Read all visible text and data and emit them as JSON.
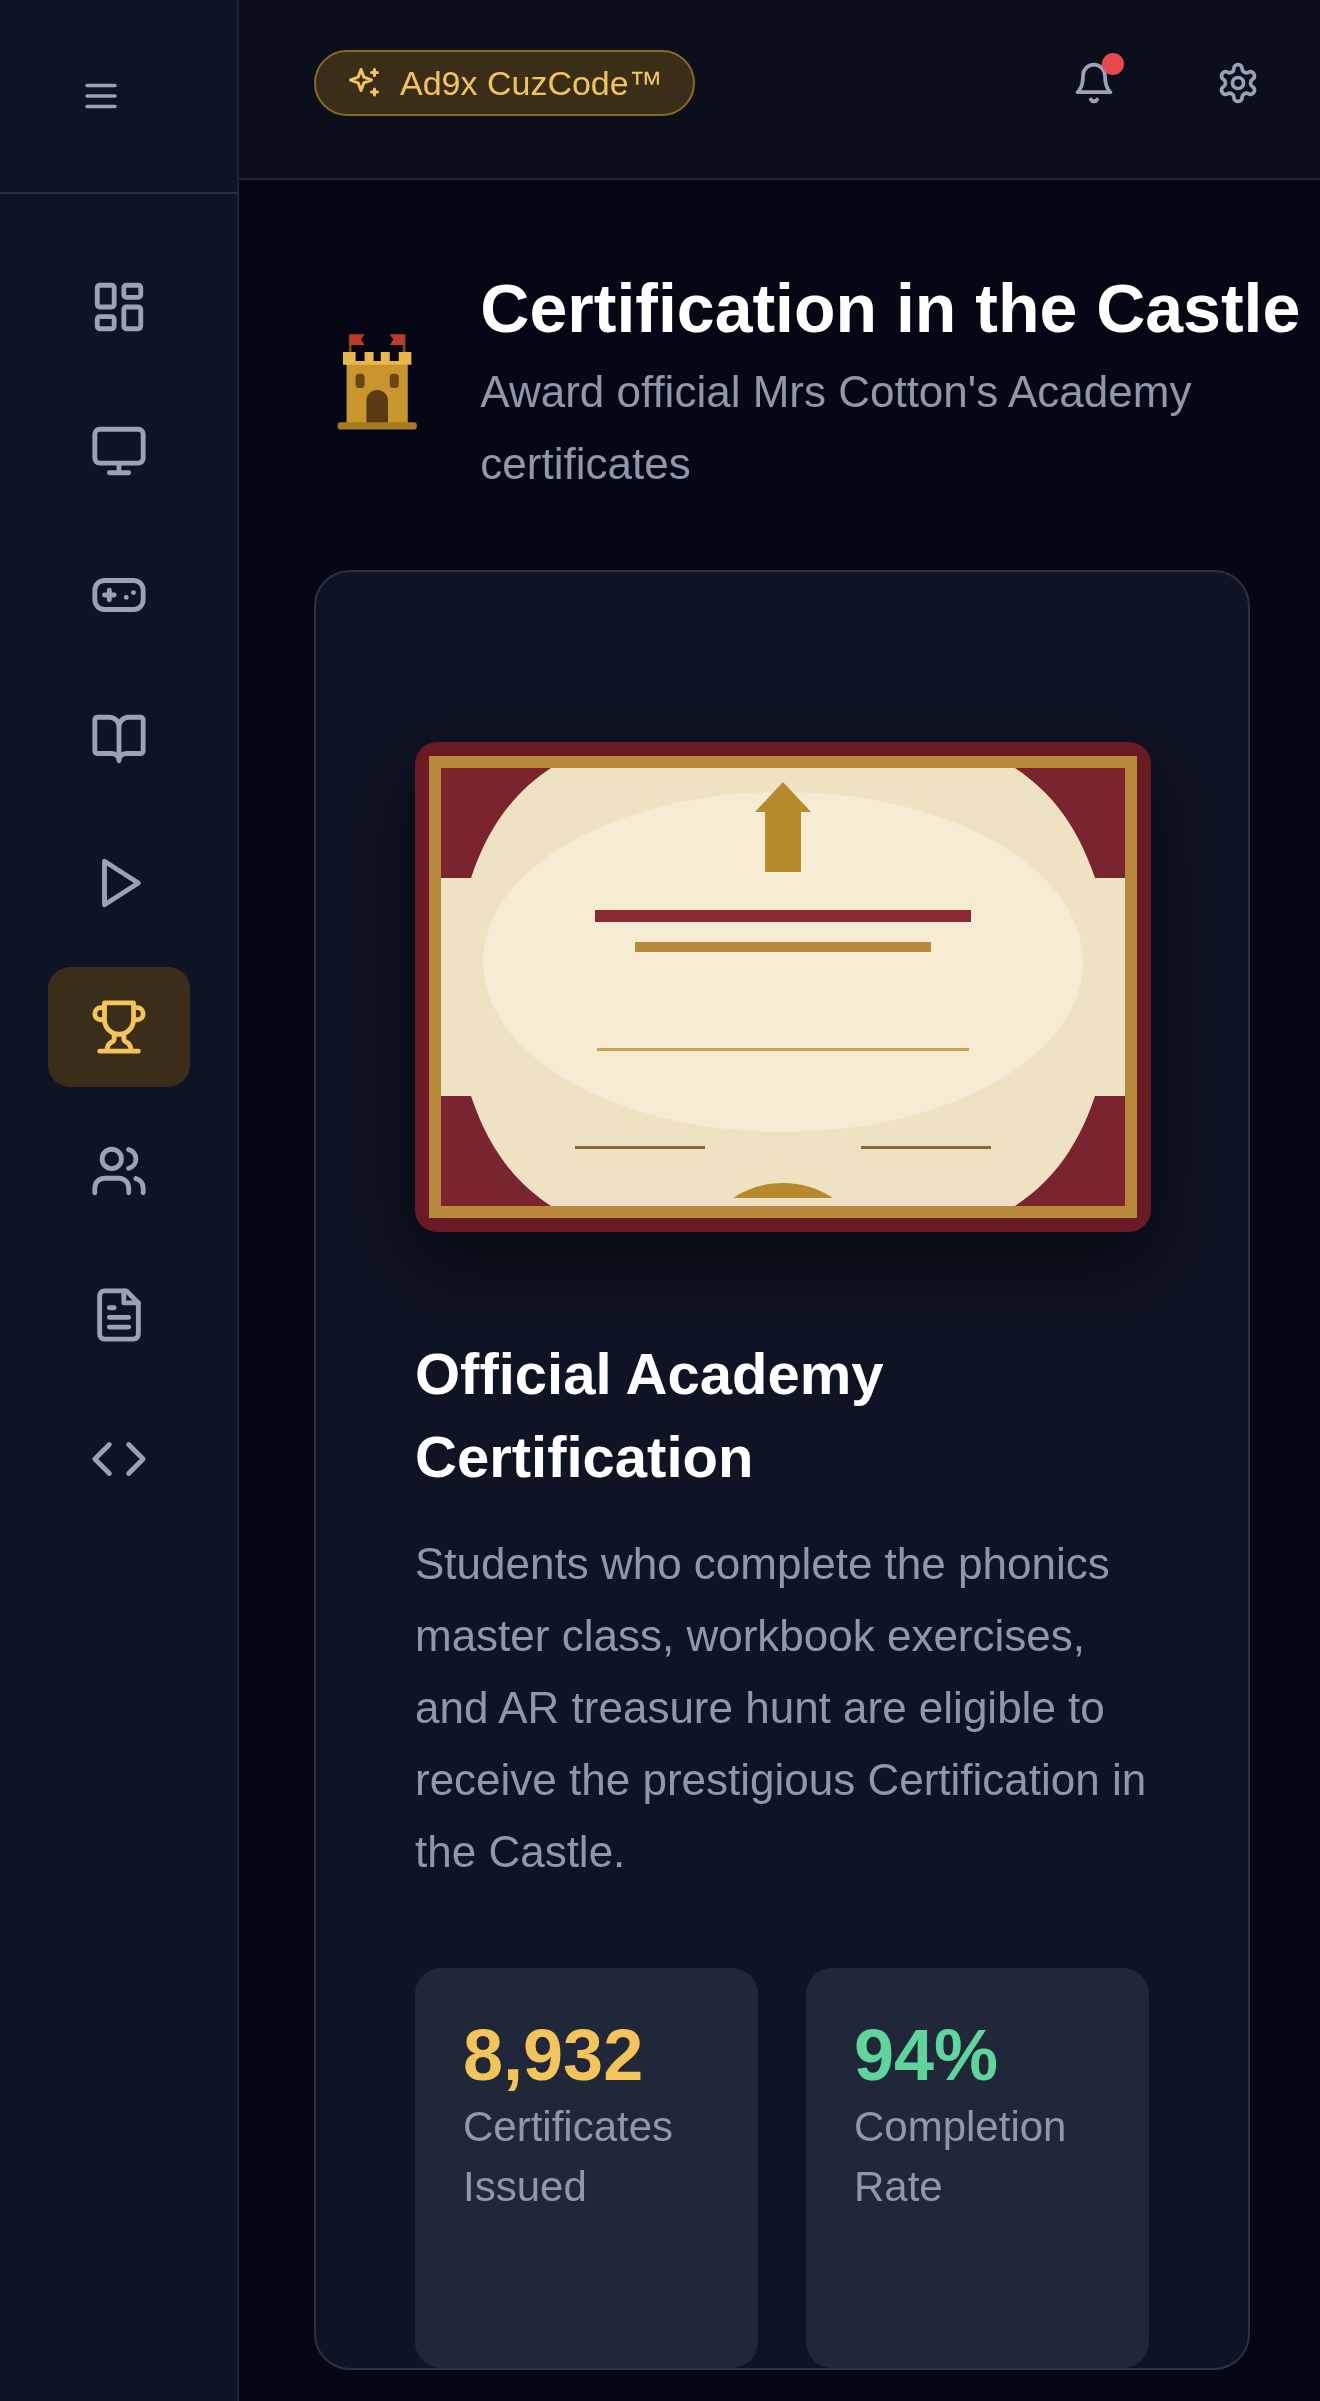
{
  "sidebar": {
    "items": [
      {
        "kind": "dashboard",
        "selected": false
      },
      {
        "kind": "monitor",
        "selected": false
      },
      {
        "kind": "gamepad",
        "selected": false
      },
      {
        "kind": "book",
        "selected": false
      },
      {
        "kind": "play",
        "selected": false
      },
      {
        "kind": "trophy",
        "selected": true
      },
      {
        "kind": "users",
        "selected": false
      },
      {
        "kind": "document",
        "selected": false
      },
      {
        "kind": "code",
        "selected": false
      }
    ]
  },
  "header": {
    "badge": "Ad9x CuzCode™",
    "notifications": {
      "unread": true
    }
  },
  "page": {
    "title": "Certification in the Castle",
    "subtitle": "Award official Mrs Cotton's Academy certificates"
  },
  "card": {
    "heading": "Official Academy Certification",
    "description": "Students who complete the phonics master class, workbook exercises, and AR treasure hunt are eligible to receive the prestigious Certification in the Castle.",
    "stats": [
      {
        "value": "8,932",
        "label": "Certificates Issued",
        "color": "#f2c45a"
      },
      {
        "value": "94%",
        "label": "Completion Rate",
        "color": "#5fd49b"
      }
    ]
  }
}
